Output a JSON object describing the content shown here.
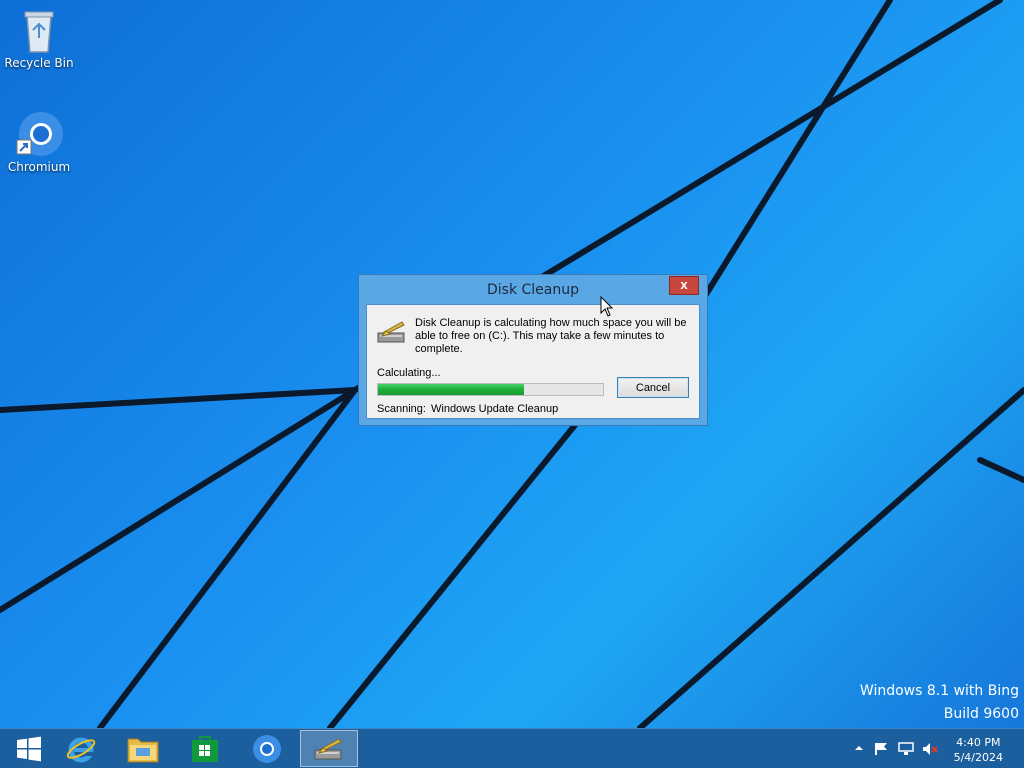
{
  "desktop": {
    "icons": [
      {
        "label": "Recycle Bin",
        "icon": "recycle-bin-icon"
      },
      {
        "label": "Chromium",
        "icon": "chromium-icon"
      }
    ],
    "watermark_line1": "Windows 8.1 with Bing",
    "watermark_line2": "Build 9600"
  },
  "dialog": {
    "title": "Disk Cleanup",
    "close_label": "x",
    "message": "Disk Cleanup is calculating how much space you will be able to free on  (C:). This may take a few minutes to complete.",
    "status_label": "Calculating...",
    "progress_fraction": 0.65,
    "cancel_label": "Cancel",
    "scanning_label": "Scanning:",
    "scanning_value": "Windows Update Cleanup"
  },
  "taskbar": {
    "buttons": [
      {
        "name": "start",
        "icon": "windows-start-icon"
      },
      {
        "name": "internet-explorer",
        "icon": "internet-explorer-icon"
      },
      {
        "name": "file-explorer",
        "icon": "file-explorer-icon"
      },
      {
        "name": "store",
        "icon": "windows-store-icon"
      },
      {
        "name": "chromium",
        "icon": "chromium-icon"
      },
      {
        "name": "disk-cleanup",
        "icon": "disk-cleanup-icon",
        "active": true
      }
    ],
    "tray_icons": [
      "show-hidden-icons-icon",
      "action-center-flag-icon",
      "network-icon",
      "volume-muted-icon"
    ],
    "clock_time": "4:40 PM",
    "clock_date": "5/4/2024"
  },
  "colors": {
    "desktop_blue": "#1a8ff0",
    "taskbar": "#1c5f9e",
    "progress_green": "#1fae3a",
    "close_red": "#c7463d"
  }
}
